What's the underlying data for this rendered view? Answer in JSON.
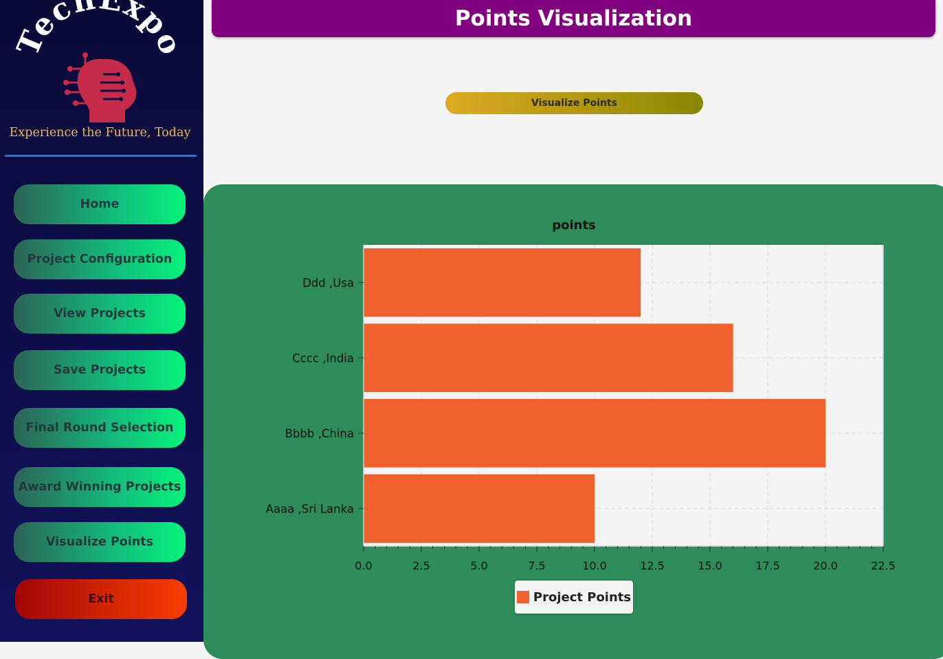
{
  "brand": {
    "logo_text": "TechExpo",
    "tagline": "Experience the Future, Today"
  },
  "sidebar": {
    "items": [
      {
        "label": "Home"
      },
      {
        "label": "Project Configuration"
      },
      {
        "label": "View Projects"
      },
      {
        "label": "Save Projects"
      },
      {
        "label": "Final Round Selection"
      },
      {
        "label": "Award Winning Projects"
      },
      {
        "label": "Visualize Points"
      }
    ],
    "exit_label": "Exit"
  },
  "header": {
    "title": "Points Visualization"
  },
  "action": {
    "visualize_label": "Visualize Points"
  },
  "colors": {
    "header": "#800080",
    "panel": "#2e8b5a",
    "bar": "#f0602d",
    "nav_accent": "#05f27b",
    "exit": "#f73d02"
  },
  "chart_data": {
    "type": "bar",
    "orientation": "horizontal",
    "title": "points",
    "categories": [
      "Aaaa ,Sri Lanka",
      "Bbbb ,China",
      "Cccc ,India",
      "Ddd ,Usa"
    ],
    "series": [
      {
        "name": "Project Points",
        "values": [
          10,
          20,
          16,
          12
        ]
      }
    ],
    "xlim": [
      0,
      22.5
    ],
    "xticks": [
      "0.0",
      "2.5",
      "5.0",
      "7.5",
      "10.0",
      "12.5",
      "15.0",
      "17.5",
      "20.0",
      "22.5"
    ],
    "grid": true,
    "legend_position": "bottom"
  }
}
